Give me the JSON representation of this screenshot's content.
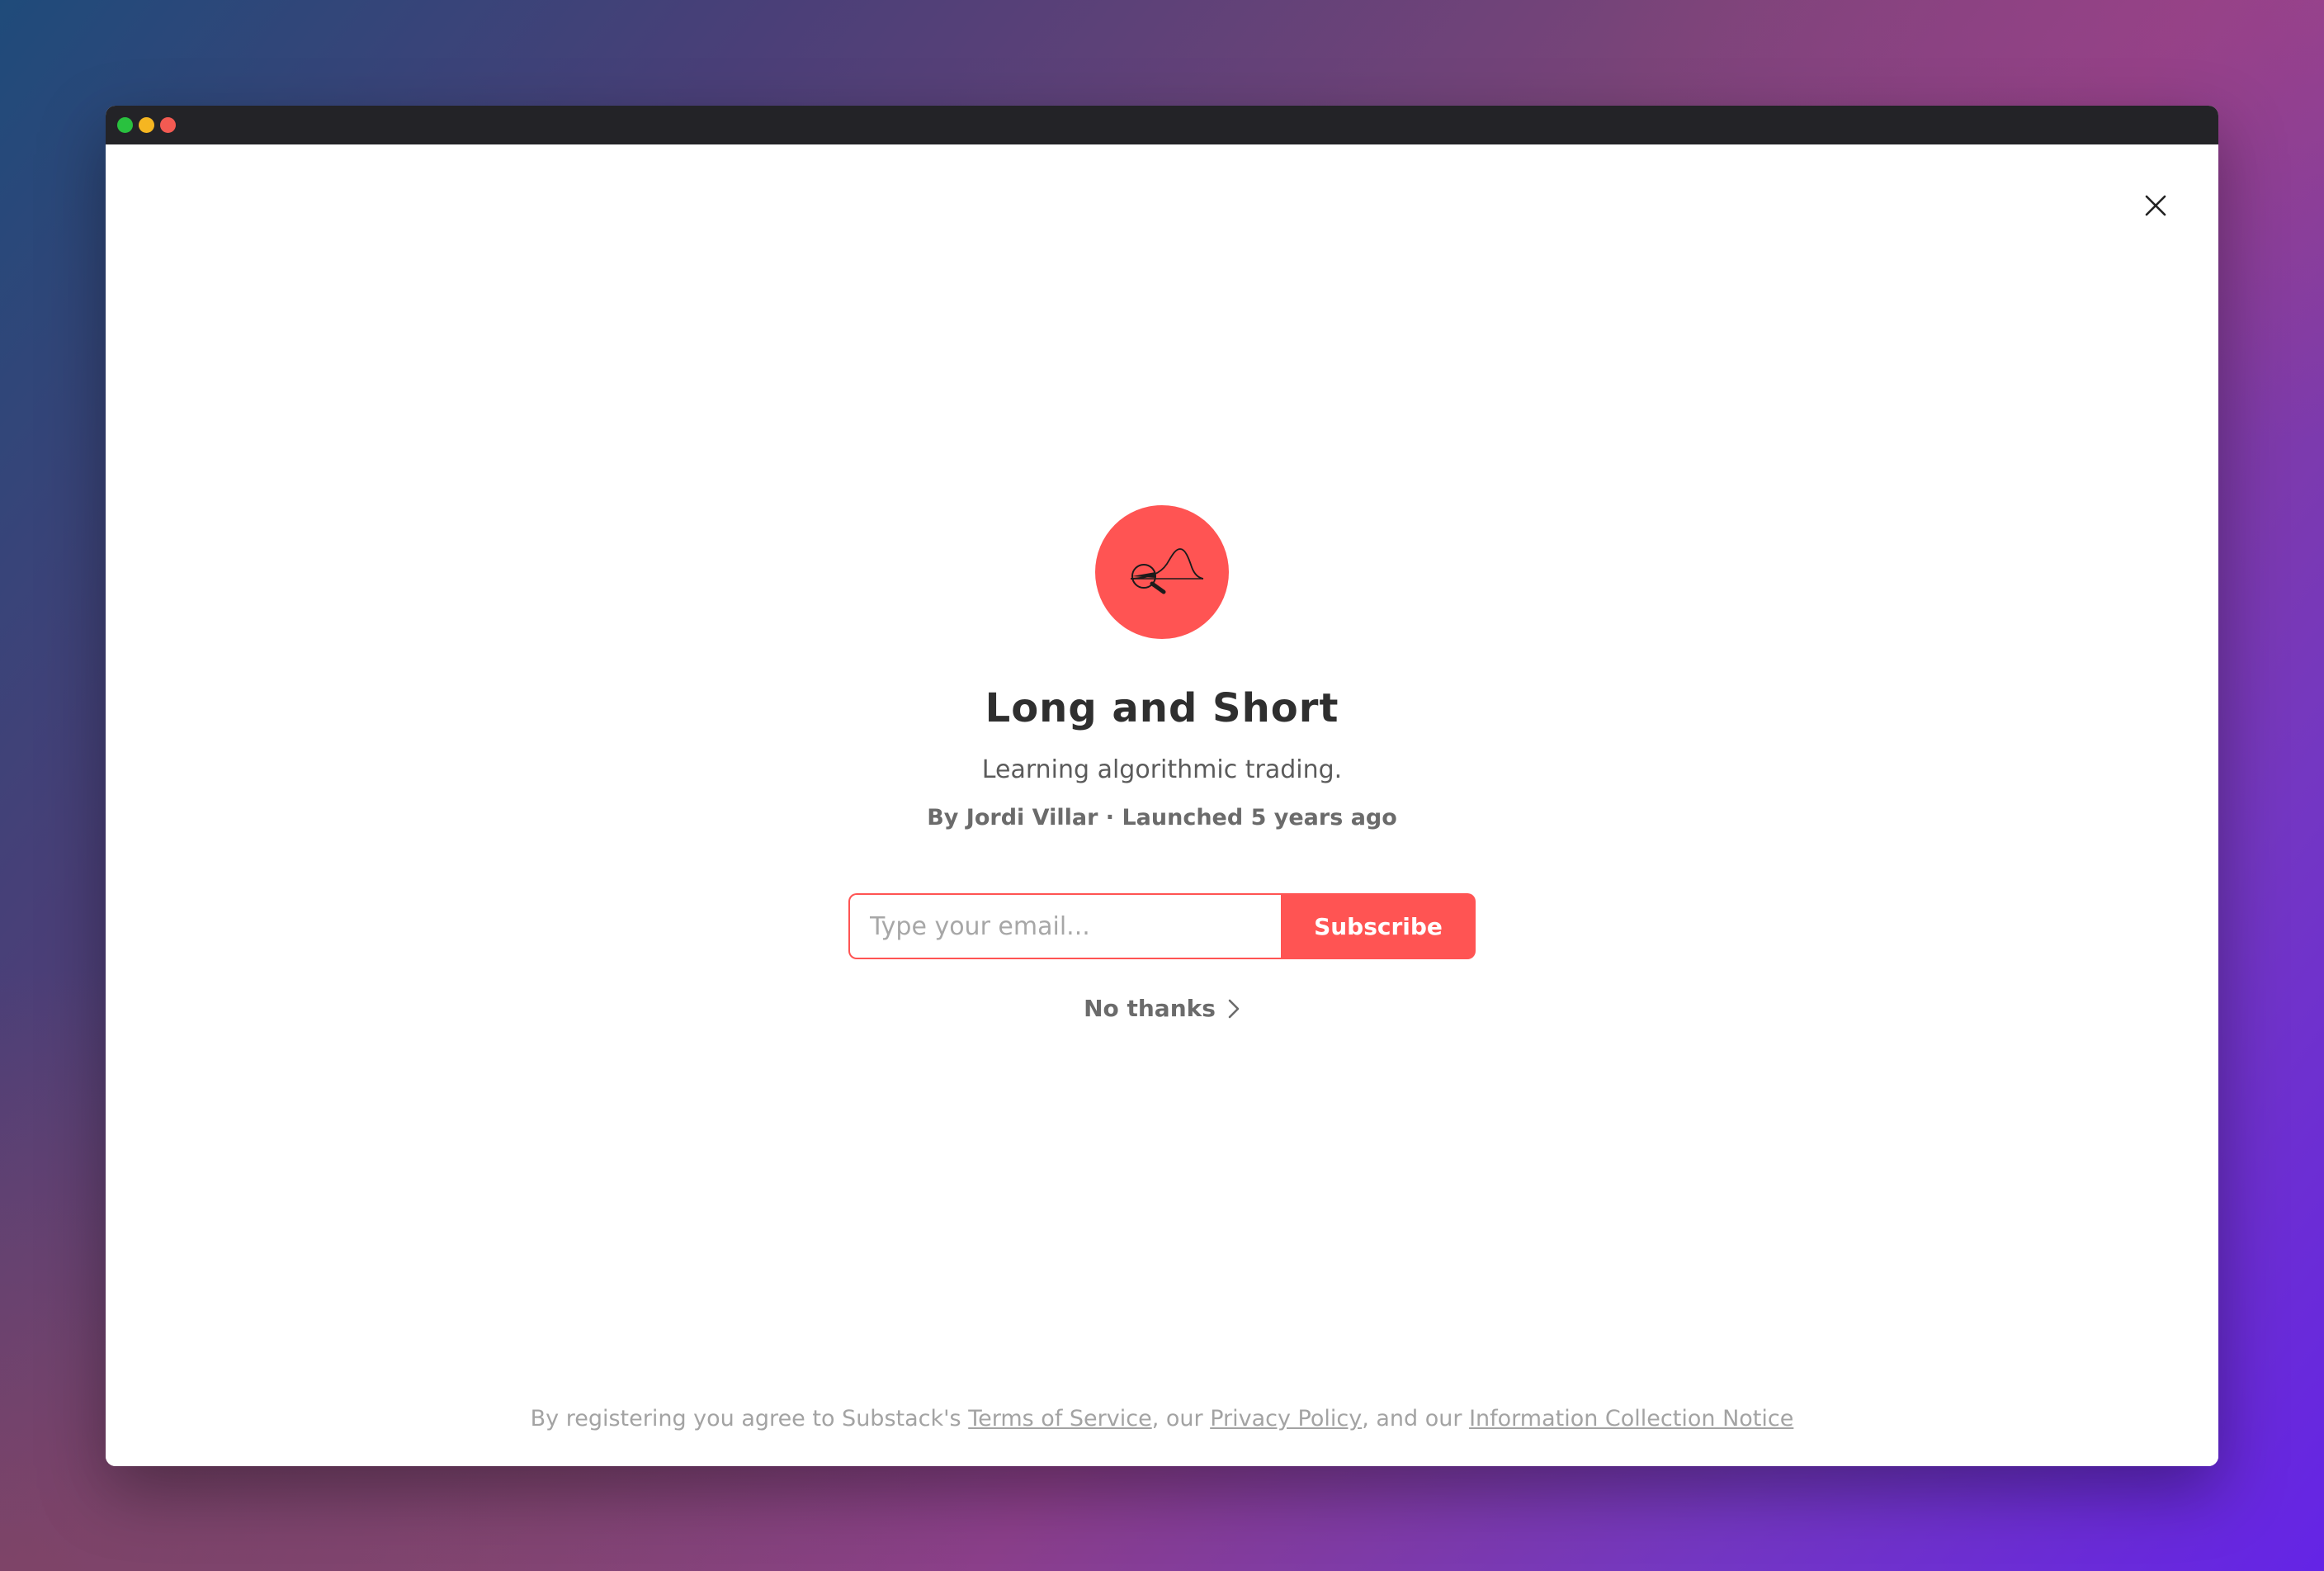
{
  "window": {
    "controls": [
      "green-dot",
      "yellow-dot",
      "red-dot"
    ]
  },
  "modal": {
    "close_icon": "close-icon",
    "logo_icon": "magnifier-bell-curve-icon",
    "accent_color": "#ff5453",
    "title": "Long and Short",
    "subtitle": "Learning algorithmic trading.",
    "byline": "By Jordi Villar · Launched 5 years ago",
    "email_placeholder": "Type your email...",
    "subscribe_label": "Subscribe",
    "no_thanks_label": "No thanks",
    "no_thanks_icon": "chevron-right-icon"
  },
  "footer": {
    "prefix": "By registering you agree to Substack's ",
    "terms_link": "Terms of Service",
    "sep1": ", our ",
    "privacy_link": "Privacy Policy",
    "sep2": ", and our ",
    "notice_link": "Information Collection Notice"
  }
}
